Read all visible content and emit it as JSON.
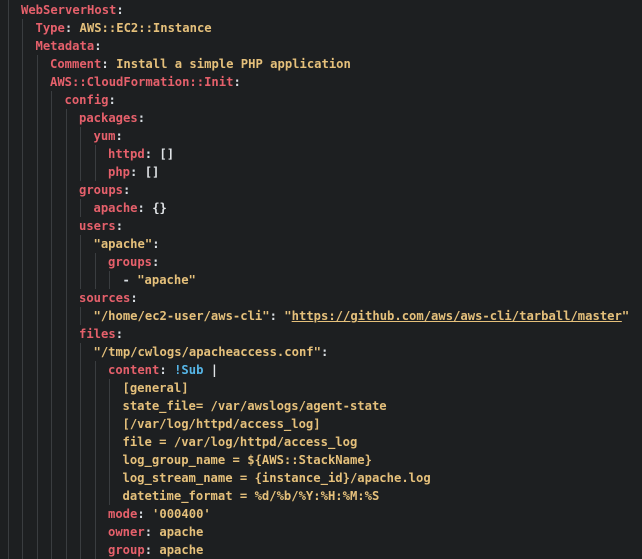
{
  "lines": [
    {
      "indent": 0,
      "key": "WebServerHost",
      "sep": ":"
    },
    {
      "indent": 1,
      "key": "Type",
      "sep": ": ",
      "value": "AWS::EC2::Instance"
    },
    {
      "indent": 1,
      "key": "Metadata",
      "sep": ":"
    },
    {
      "indent": 2,
      "key": "Comment",
      "sep": ": ",
      "value": "Install a simple PHP application"
    },
    {
      "indent": 2,
      "key": "AWS::CloudFormation::Init",
      "sep": ":"
    },
    {
      "indent": 3,
      "key": "config",
      "sep": ":"
    },
    {
      "indent": 4,
      "key": "packages",
      "sep": ":"
    },
    {
      "indent": 5,
      "key": "yum",
      "sep": ":"
    },
    {
      "indent": 6,
      "key": "httpd",
      "sep": ": ",
      "plain": "[]"
    },
    {
      "indent": 6,
      "key": "php",
      "sep": ": ",
      "plain": "[]"
    },
    {
      "indent": 4,
      "key": "groups",
      "sep": ":"
    },
    {
      "indent": 5,
      "key": "apache",
      "sep": ": ",
      "plain": "{}"
    },
    {
      "indent": 4,
      "key": "users",
      "sep": ":"
    },
    {
      "indent": 5,
      "qkey": "\"apache\"",
      "sep": ":"
    },
    {
      "indent": 6,
      "key": "groups",
      "sep": ":"
    },
    {
      "indent": 7,
      "dash": "- ",
      "value": "\"apache\""
    },
    {
      "indent": 4,
      "key": "sources",
      "sep": ":"
    },
    {
      "indent": 5,
      "qkey": "\"/home/ec2-user/aws-cli\"",
      "sep": ": ",
      "qopen": "\"",
      "link": "https://github.com/aws/aws-cli/tarball/master",
      "qclose": "\""
    },
    {
      "indent": 4,
      "key": "files",
      "sep": ":"
    },
    {
      "indent": 5,
      "qkey": "\"/tmp/cwlogs/apacheaccess.conf\"",
      "sep": ":"
    },
    {
      "indent": 6,
      "key": "content",
      "sep": ": ",
      "tag": "!Sub",
      "plain": " |"
    },
    {
      "indent": 7,
      "value": "[general]"
    },
    {
      "indent": 7,
      "value": "state_file= /var/awslogs/agent-state"
    },
    {
      "indent": 7,
      "value": "[/var/log/httpd/access_log]"
    },
    {
      "indent": 7,
      "value": "file = /var/log/httpd/access_log"
    },
    {
      "indent": 7,
      "value": "log_group_name = ${AWS::StackName}"
    },
    {
      "indent": 7,
      "value": "log_stream_name = {instance_id}/apache.log"
    },
    {
      "indent": 7,
      "value": "datetime_format = %d/%b/%Y:%H:%M:%S"
    },
    {
      "indent": 6,
      "key": "mode",
      "sep": ": ",
      "value": "'000400'"
    },
    {
      "indent": 6,
      "key": "owner",
      "sep": ": ",
      "value": "apache"
    },
    {
      "indent": 6,
      "key": "group",
      "sep": ": ",
      "value": "apache"
    }
  ]
}
